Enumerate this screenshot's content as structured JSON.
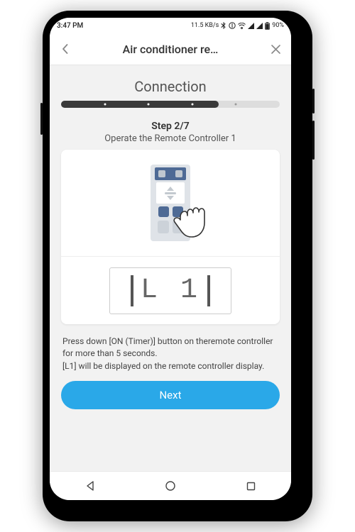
{
  "status": {
    "time": "3:47 PM",
    "speed": "11.5 KB/s",
    "battery": "90%"
  },
  "appbar": {
    "title": "Air conditioner re…"
  },
  "page": {
    "section_title": "Connection",
    "progress_fill_pct": 72,
    "step_label": "Step 2/7",
    "step_subtitle": "Operate the Remote Controller 1",
    "lcd_code": "L 1",
    "instructions_line1": "Press down [ON (Timer)] button on theremote controller for more than 5 seconds.",
    "instructions_line2": "[L1] will be displayed on the remote controller display.",
    "primary_button": "Next"
  }
}
